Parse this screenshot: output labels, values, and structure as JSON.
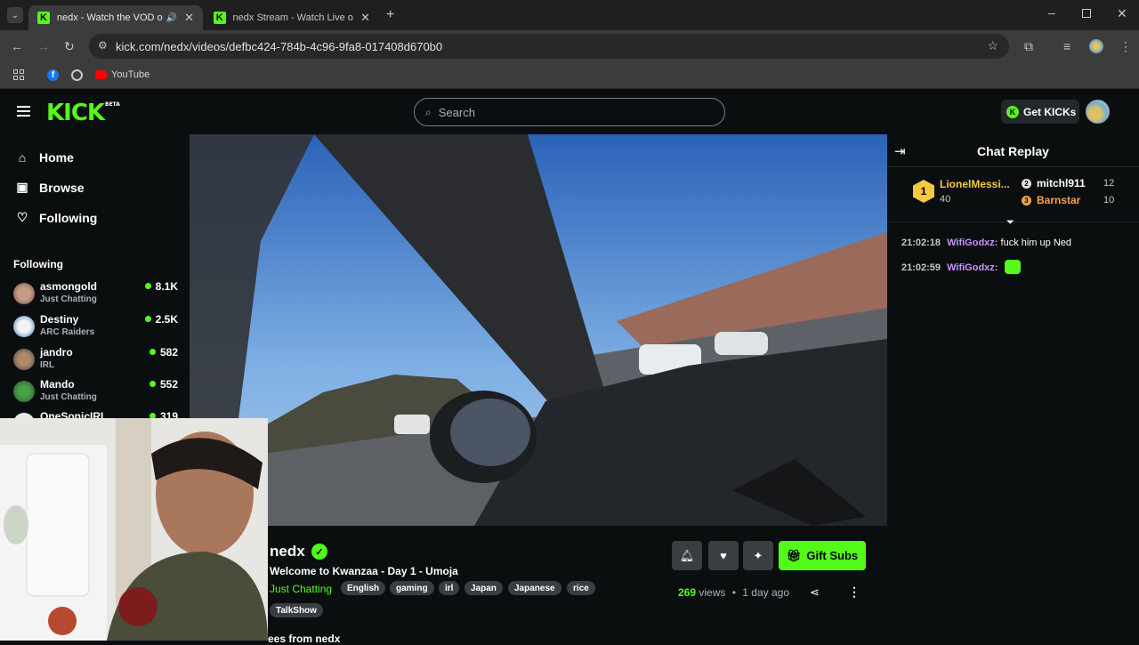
{
  "browser": {
    "tabs": [
      {
        "title": "nedx - Watch the VOD on Kick",
        "active": true
      },
      {
        "title": "nedx Stream - Watch Live on Kick",
        "active": false
      }
    ],
    "url": "kick.com/nedx/videos/defbc424-784b-4c96-9fa8-017408d670b0",
    "bookmarks": [
      {
        "label": "YouTube"
      }
    ],
    "colors": {
      "tabbar": "#1f1f1f",
      "toolbar": "#3c3c3c"
    }
  },
  "header": {
    "logo": "KICK",
    "logo_badge": "BETA",
    "search_placeholder": "Search",
    "get_kicks_label": "Get KICKs"
  },
  "sidebar": {
    "nav": [
      {
        "label": "Home",
        "icon": "home-icon"
      },
      {
        "label": "Browse",
        "icon": "browse-icon"
      },
      {
        "label": "Following",
        "icon": "heart-icon"
      }
    ],
    "following_heading": "Following",
    "following": [
      {
        "name": "asmongold",
        "category": "Just Chatting",
        "viewers": "8.1K"
      },
      {
        "name": "Destiny",
        "category": "ARC Raiders",
        "viewers": "2.5K"
      },
      {
        "name": "jandro",
        "category": "IRL",
        "viewers": "582"
      },
      {
        "name": "Mando",
        "category": "Just Chatting",
        "viewers": "552"
      },
      {
        "name": "OneSonicIRL",
        "category": "",
        "viewers": "319"
      }
    ]
  },
  "video": {
    "streamer": "nedx",
    "title": "Welcome to Kwanzaa - Day 1 - Umoja",
    "category": "Just Chatting",
    "tags": [
      "English",
      "gaming",
      "irl",
      "Japan",
      "Japanese",
      "rice",
      "TalkShow"
    ],
    "views": "269",
    "views_label": "views",
    "age": "1 day ago",
    "gift_subs_label": "Gift Subs",
    "more_heading": "ees from nedx"
  },
  "chat": {
    "title": "Chat Replay",
    "leaderboard": [
      {
        "rank": "1",
        "name": "LionelMessi...",
        "count": "40",
        "color": "#f5c842"
      },
      {
        "rank": "2",
        "name": "mitchl911",
        "count": "12",
        "color": "#ffffff"
      },
      {
        "rank": "3",
        "name": "Barnstar",
        "count": "10",
        "color": "#f3a44a"
      }
    ],
    "messages": [
      {
        "time": "21:02:18",
        "user": "WifiGodxz:",
        "text": "fuck him up Ned"
      },
      {
        "time": "21:02:59",
        "user": "WifiGodxz:",
        "text": ""
      }
    ]
  },
  "colors": {
    "accent": "#53fc18",
    "background": "#0b0e0f",
    "chip": "#3a3d42"
  }
}
